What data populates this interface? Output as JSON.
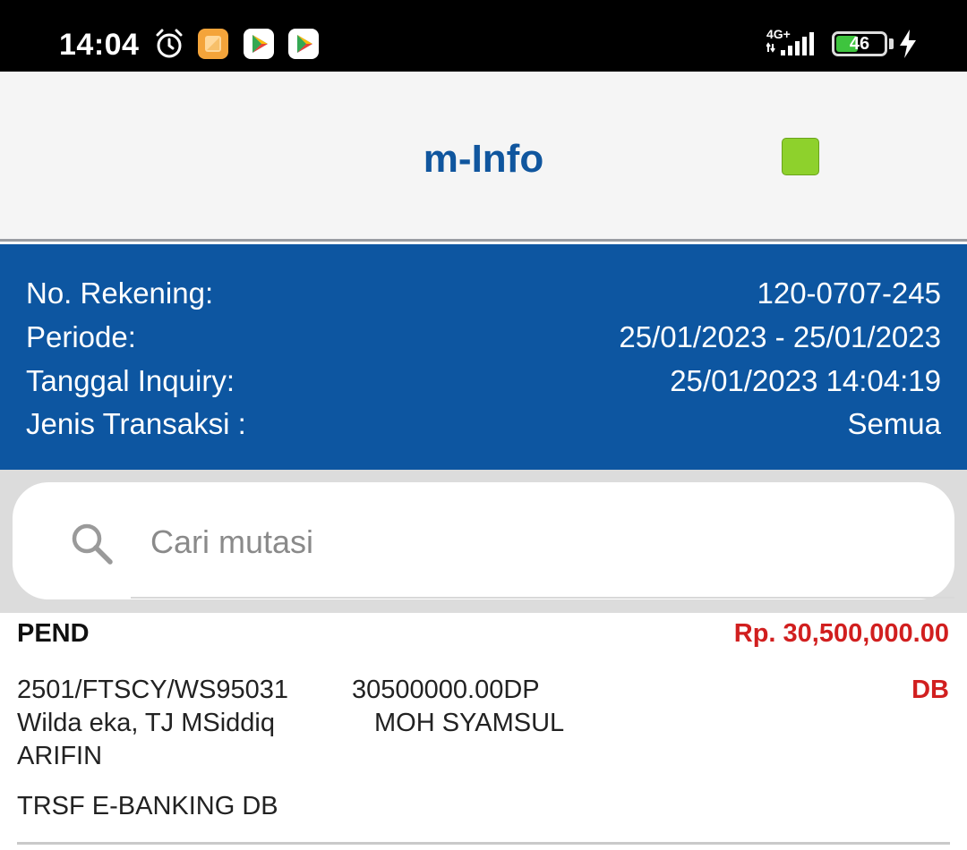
{
  "status_bar": {
    "time": "14:04",
    "network": "4G+",
    "battery": "46",
    "icons": [
      "alarm-icon",
      "app-notification-icon",
      "play-store-icon",
      "play-store-icon",
      "signal-icon",
      "battery-icon",
      "charging-icon"
    ]
  },
  "app_bar": {
    "title": "m-Info",
    "indicator_color": "#8ed12c"
  },
  "account_info": {
    "rekening_label": "No. Rekening:",
    "rekening_value": "120-0707-245",
    "periode_label": "Periode:",
    "periode_value": "25/01/2023 - 25/01/2023",
    "inquiry_label": "Tanggal Inquiry:",
    "inquiry_value": "25/01/2023 14:04:19",
    "jenis_label": "Jenis Transaksi :",
    "jenis_value": "Semua"
  },
  "search": {
    "placeholder": "Cari mutasi",
    "value": ""
  },
  "transactions": [
    {
      "status": "PEND",
      "amount": "Rp. 30,500,000.00",
      "line1_left": "2501/FTSCY/WS95031",
      "line1_right": "30500000.00DP",
      "line2_left": "Wilda eka, TJ MSiddiq",
      "line2_right": "MOH SYAMSUL",
      "line3": "ARIFIN",
      "description": "TRSF E-BANKING DB",
      "type": "DB"
    }
  ],
  "colors": {
    "brand_blue": "#0d56a1",
    "title_blue": "#10569e",
    "debit_red": "#d11f1f"
  }
}
